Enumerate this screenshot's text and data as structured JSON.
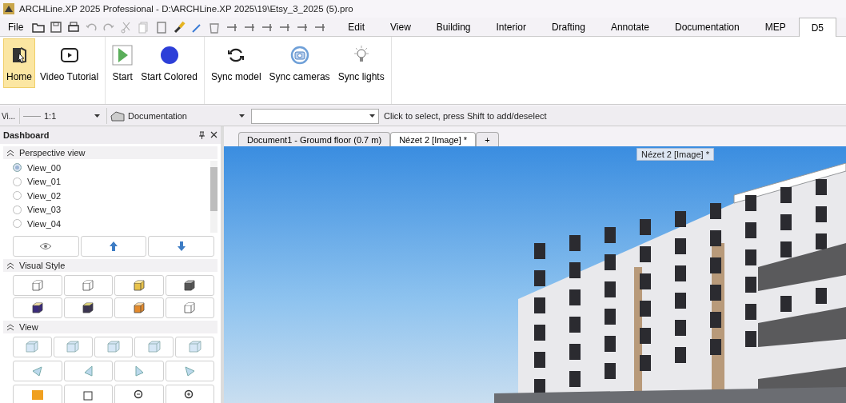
{
  "window": {
    "title": "ARCHLine.XP 2025 Professional - D:\\ARCHLine.XP 2025\\19\\Etsy_3_2025 (5).pro"
  },
  "file_menu": "File",
  "ribbon_tabs": [
    {
      "label": "Edit",
      "selected": false
    },
    {
      "label": "View",
      "selected": false
    },
    {
      "label": "Building",
      "selected": false
    },
    {
      "label": "Interior",
      "selected": false
    },
    {
      "label": "Drafting",
      "selected": false
    },
    {
      "label": "Annotate",
      "selected": false
    },
    {
      "label": "Documentation",
      "selected": false
    },
    {
      "label": "MEP",
      "selected": false
    },
    {
      "label": "D5",
      "selected": true
    }
  ],
  "ribbon_groups": [
    {
      "buttons": [
        {
          "kind": "home",
          "label": "Home",
          "selected": true
        },
        {
          "kind": "video",
          "label": "Video Tutorial",
          "selected": false
        }
      ]
    },
    {
      "buttons": [
        {
          "kind": "start",
          "label": "Start",
          "selected": false
        },
        {
          "kind": "dot",
          "label": "Start Colored",
          "selected": false
        }
      ]
    },
    {
      "buttons": [
        {
          "kind": "sync",
          "label": "Sync model",
          "selected": false
        },
        {
          "kind": "camera",
          "label": "Sync cameras",
          "selected": false
        },
        {
          "kind": "bulb",
          "label": "Sync lights",
          "selected": false
        }
      ]
    }
  ],
  "toolbar": {
    "panel_label": "Vi...",
    "scale": "1:1",
    "layer": "Documentation",
    "status": "Click to select, press Shift to add/deselect"
  },
  "dashboard": {
    "title": "Dashboard",
    "sections": [
      {
        "kind": "views",
        "title": "Perspective view",
        "expanded": true,
        "items": [
          {
            "label": "View_00",
            "selected": true
          },
          {
            "label": "View_01",
            "selected": false
          },
          {
            "label": "View_02",
            "selected": false
          },
          {
            "label": "View_03",
            "selected": false
          },
          {
            "label": "View_04",
            "selected": false
          }
        ]
      },
      {
        "kind": "styles",
        "title": "Visual Style",
        "expanded": true
      },
      {
        "kind": "viewtools",
        "title": "View",
        "expanded": true
      }
    ]
  },
  "document_tabs": [
    {
      "label": "Document1 - Groumd floor (0.7 m)",
      "selected": false
    },
    {
      "label": "Nézet 2 [Image] *",
      "selected": true
    },
    {
      "label": "+",
      "selected": false
    }
  ],
  "viewport": {
    "caption": "Nézet 2 [Image] *"
  }
}
